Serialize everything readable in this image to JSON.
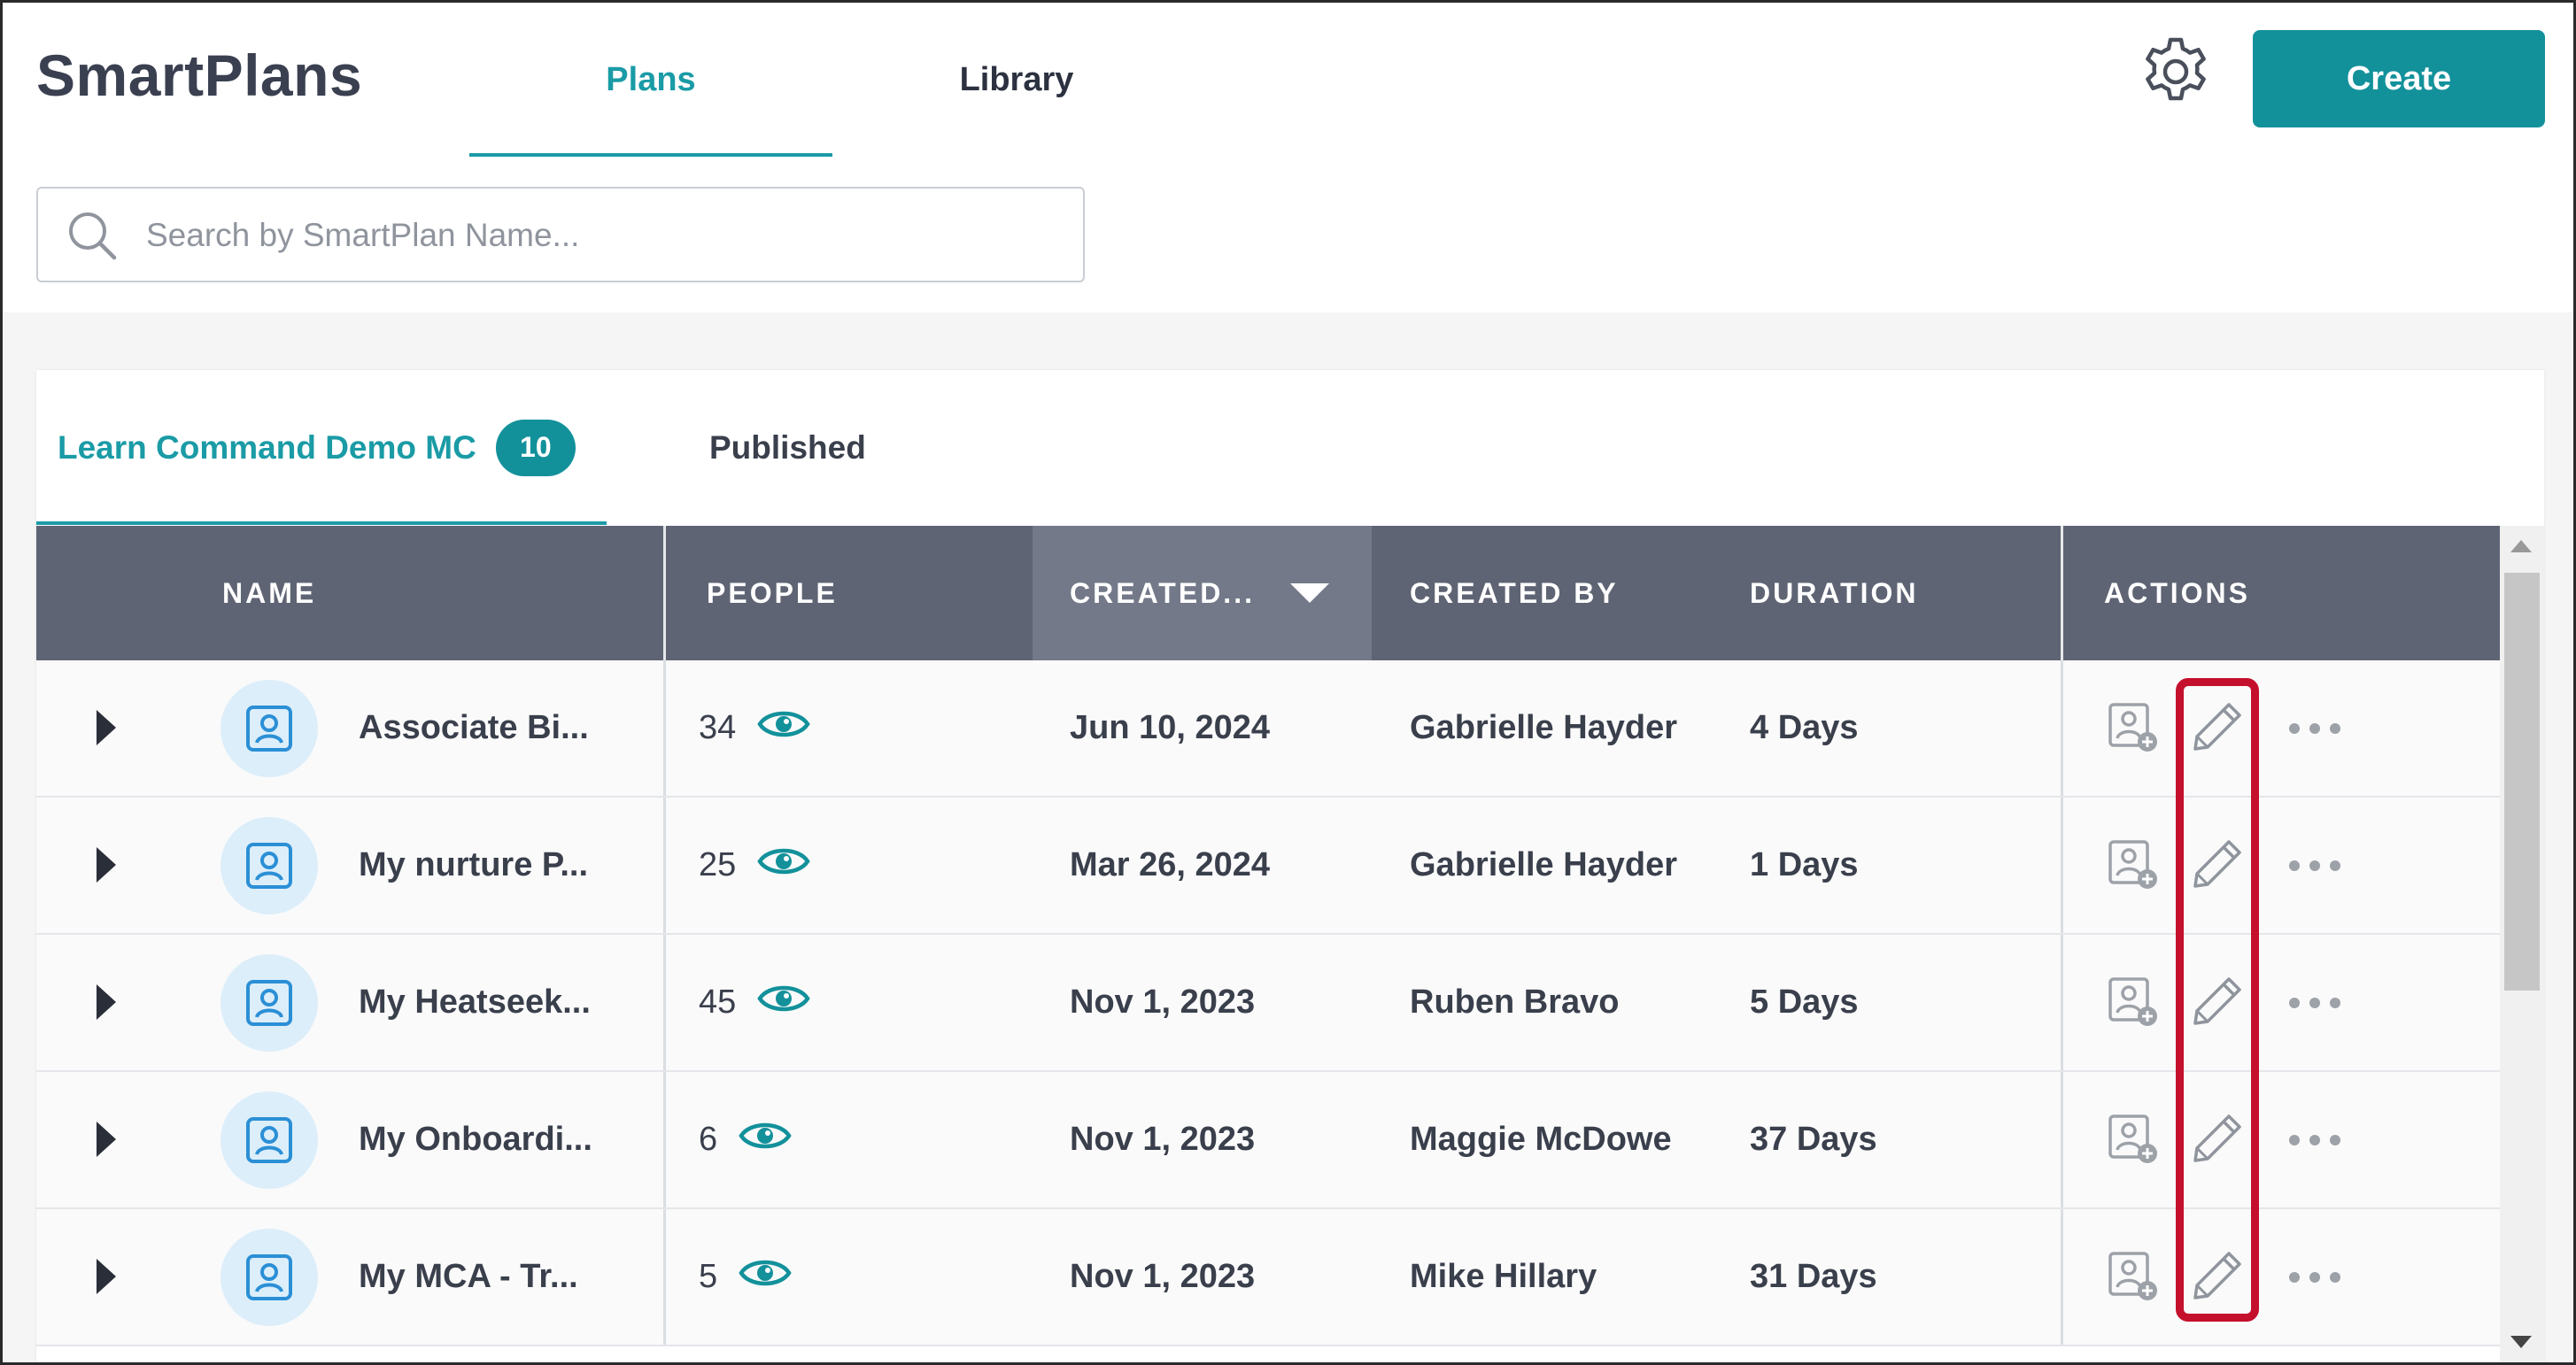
{
  "app": {
    "title": "SmartPlans"
  },
  "nav": {
    "tabs": [
      {
        "label": "Plans"
      },
      {
        "label": "Library"
      }
    ]
  },
  "header": {
    "create_label": "Create"
  },
  "search": {
    "placeholder": "Search by SmartPlan Name..."
  },
  "subtabs": [
    {
      "label": "Learn Command Demo MC",
      "count": "10"
    },
    {
      "label": "Published"
    }
  ],
  "table": {
    "columns": [
      "NAME",
      "PEOPLE",
      "CREATED...",
      "CREATED BY",
      "DURATION",
      "ACTIONS"
    ],
    "sorted_column": "CREATED...",
    "rows": [
      {
        "name": "Associate Bi...",
        "people": "34",
        "created": "Jun 10, 2024",
        "created_by": "Gabrielle Hayder",
        "duration": "4 Days"
      },
      {
        "name": "My nurture P...",
        "people": "25",
        "created": "Mar 26, 2024",
        "created_by": "Gabrielle Hayder",
        "duration": "1 Days"
      },
      {
        "name": "My Heatseek...",
        "people": "45",
        "created": "Nov 1, 2023",
        "created_by": "Ruben Bravo",
        "duration": "5 Days"
      },
      {
        "name": "My Onboardi...",
        "people": "6",
        "created": "Nov 1, 2023",
        "created_by": "Maggie McDowe",
        "duration": "37 Days"
      },
      {
        "name": "My MCA - Tr...",
        "people": "5",
        "created": "Nov 1, 2023",
        "created_by": "Mike Hillary",
        "duration": "31 Days"
      }
    ]
  },
  "icons": {
    "settings": "gear-icon",
    "search": "search-icon",
    "row_expand": "caret-right-icon",
    "plan": "user-profile-icon",
    "people_view": "eye-icon",
    "assign": "add-user-icon",
    "edit": "pencil-icon",
    "more": "more-horizontal-icon"
  },
  "colors": {
    "accent": "#13919b",
    "header_bg": "#5f6474",
    "highlight": "#c4102c"
  }
}
